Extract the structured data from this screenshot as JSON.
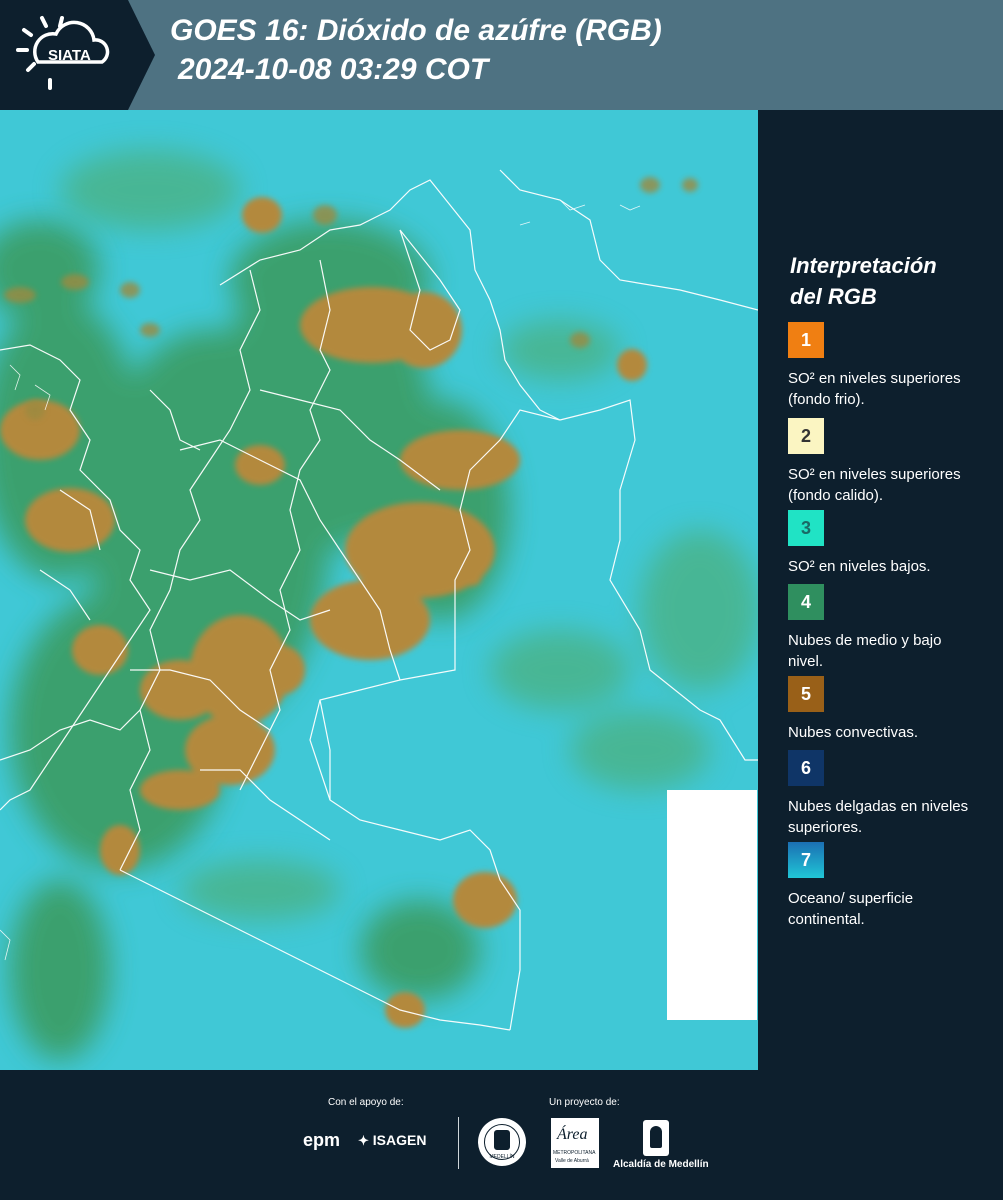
{
  "header": {
    "logo_text": "SIATA",
    "title_line1": "GOES 16: Dióxido de azúfre (RGB)",
    "title_line2": "2024-10-08 03:29 COT"
  },
  "map": {
    "description_colors": {
      "land_cyan": "#3fc6d4",
      "low_cloud": "#3f9a5a",
      "convective": "#b3893d",
      "borders": "#ffffff"
    }
  },
  "legend": {
    "title_line1": "Interpretación",
    "title_line2": "del RGB",
    "items": [
      {
        "number": "1",
        "color": "#f07f12",
        "text_color": "#ffffff",
        "label": "SO² en niveles superiores (fondo frio)."
      },
      {
        "number": "2",
        "color": "#fbf5c2",
        "text_color": "#333333",
        "label": "SO² en niveles superiores (fondo calido)."
      },
      {
        "number": "3",
        "color": "#20e3c5",
        "text_color": "#1a6a66",
        "label": "SO² en niveles bajos."
      },
      {
        "number": "4",
        "color": "#2f8f5f",
        "text_color": "#ffffff",
        "label": "Nubes de medio y bajo nivel."
      },
      {
        "number": "5",
        "color": "#996018",
        "text_color": "#ffffff",
        "label": "Nubes convectivas."
      },
      {
        "number": "6",
        "color": "#0f3567",
        "text_color": "#ffffff",
        "label": "Nubes delgadas en niveles superiores."
      },
      {
        "number": "7",
        "color": "#1b9fc3",
        "text_color": "#ffffff",
        "label": "Oceano/ superficie continental."
      }
    ]
  },
  "footer": {
    "support_label": "Con el apoyo de:",
    "project_label": "Un proyecto de:",
    "sponsor1": "epm",
    "sponsor2": "ISAGEN",
    "partner_area": "Área",
    "partner_area_sub": "METROPOLITANA",
    "partner_area_sub2": "Valle de Aburrá",
    "partner_alcaldia": "Alcaldía de Medellín",
    "seal_text": "MEDELLÍN"
  }
}
